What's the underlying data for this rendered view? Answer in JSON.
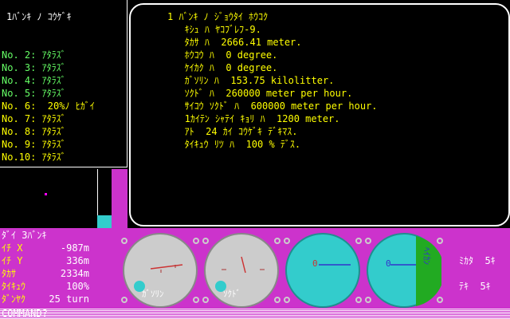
{
  "list_panel": {
    "title": "1ﾊﾞﾝｷ ﾉ ｺｳｹﾞｷ",
    "items": [
      {
        "text": "No. 2: ｱﾀﾗｽﾞ",
        "color": "#66ff66"
      },
      {
        "text": "No. 3: ｱﾀﾗｽﾞ",
        "color": "#66ff66"
      },
      {
        "text": "No. 4: ｱﾀﾗｽﾞ",
        "color": "#66ff66"
      },
      {
        "text": "No. 5: ｱﾀﾗｽﾞ",
        "color": "#66ff66"
      },
      {
        "text": "No. 6:  20%ﾉ ﾋｶﾞｲ",
        "color": "#ffff00"
      },
      {
        "text": "No. 7: ｱﾀﾗｽﾞ",
        "color": "#ffff00"
      },
      {
        "text": "No. 8: ｱﾀﾗｽﾞ",
        "color": "#ffff00"
      },
      {
        "text": "No. 9: ｱﾀﾗｽﾞ",
        "color": "#ffff00"
      },
      {
        "text": "No.10: ｱﾀﾗｽﾞ",
        "color": "#ffff00"
      }
    ]
  },
  "message_panel": {
    "lines": [
      "1 ﾊﾞﾝｷ ﾉ ｼﾞｮｳﾀｲ ﾎｳｺｸ",
      "   ｷｼｭ ﾊ ﾔｺﾌﾞﾚﾌ-9.",
      "   ﾀｶｻ ﾊ  2666.41 meter.",
      "   ﾎｳｺｳ ﾊ  0 degree.",
      "   ｹｲｶｸ ﾊ  0 degree.",
      "   ｶﾞｿﾘﾝ ﾊ  153.75 kilolitter.",
      "   ｿｸﾄﾞ ﾊ  260000 meter per hour.",
      "   ｻｲｺｳ ｿｸﾄﾞ ﾊ  600000 meter per hour.",
      "   1ｶｲﾃﾝ ｼｬﾃｲ ｷｮﾘ ﾊ  1200 meter.",
      "   ｱﾄ  24 ｶｲ ｺｳｹﾞｷ ﾃﾞｷﾏｽ.",
      "   ﾀｲｷｭｳ ﾘﾂ ﾊ  100 % ﾃﾞｽ."
    ]
  },
  "status": {
    "header": "ﾀﾞｲ 3ﾊﾞﾝｷ",
    "rows": [
      {
        "label": "ｲﾁ X",
        "value": "-987m"
      },
      {
        "label": "ｲﾁ Y",
        "value": "336m"
      },
      {
        "label": "ﾀｶｻ",
        "value": "2334m"
      },
      {
        "label": "ﾀｲｷｭｳ",
        "value": "100%"
      },
      {
        "label": "ﾀﾞﾝﾔｸ",
        "value": "25 turn"
      }
    ]
  },
  "gauges": {
    "fuel_label": "ｶﾞｿﾘﾝ",
    "speed_label": "ｿｸﾄﾞ",
    "side_label": "ﾍｲｶﾝ"
  },
  "right_panel": {
    "ally_label": "ﾐｶﾀ  5ｷ",
    "enemy_label": "ﾃｷ  5ｷ"
  },
  "command_prompt": "COMMAND?"
}
